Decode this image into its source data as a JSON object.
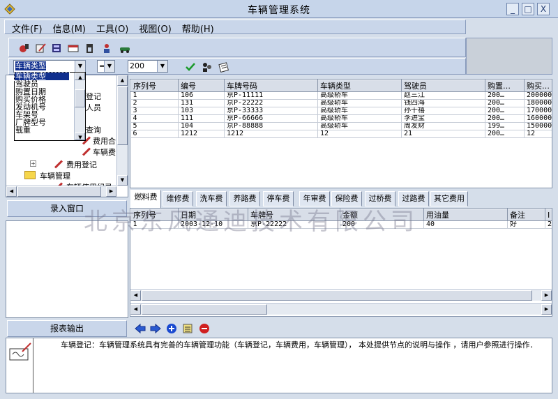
{
  "window": {
    "title": "车辆管理系统",
    "min": "_",
    "max": "□",
    "close": "X"
  },
  "menu": [
    {
      "label": "文件(F)"
    },
    {
      "label": "信息(M)"
    },
    {
      "label": "工具(O)"
    },
    {
      "label": "视图(O)"
    },
    {
      "label": "帮助(H)"
    }
  ],
  "filter": {
    "field": "车辆类型",
    "operator": "=",
    "value": "200"
  },
  "dropdown_options": [
    "车辆类型",
    "驾驶员",
    "购置日期",
    "购买价格",
    "发动机号",
    "车架号",
    "厂牌型号",
    "载重"
  ],
  "tree": {
    "nodes": [
      "登记",
      "人员",
      "查询",
      "费用合",
      "车辆费",
      "费用登记",
      "车辆管理",
      "车辆使用纪录"
    ]
  },
  "side": {
    "entry_header": "录入窗口",
    "report_header": "报表输出"
  },
  "vehicles": {
    "columns": [
      "序列号",
      "编号",
      "车牌号码",
      "车辆类型",
      "驾驶员",
      "购置…",
      "购买…"
    ],
    "rows": [
      [
        "1",
        "106",
        "京P-11111",
        "高级轿车",
        "赵三江",
        "200…",
        "200000"
      ],
      [
        "2",
        "131",
        "京P-22222",
        "高级轿车",
        "钱四海",
        "200…",
        "180000"
      ],
      [
        "3",
        "103",
        "京P-33333",
        "高级轿车",
        "孙千禧",
        "200…",
        "170000"
      ],
      [
        "4",
        "111",
        "京P-66666",
        "高级轿车",
        "李进宝",
        "200…",
        "160000"
      ],
      [
        "5",
        "104",
        "京P-88888",
        "高级轿车",
        "周发财",
        "199…",
        "150000"
      ],
      [
        "6",
        "1212",
        "1212",
        "12",
        "21",
        "200…",
        "12"
      ]
    ]
  },
  "tabs": [
    "燃料费",
    "维修费",
    "洗车费",
    "养路费",
    "停车费",
    "年审费",
    "保险费",
    "过桥费",
    "过路费",
    "其它费用"
  ],
  "fuel": {
    "columns": [
      "序列号",
      "日期",
      "车牌号",
      "金额",
      "用油量",
      "备注",
      "I"
    ],
    "rows": [
      [
        "1",
        "2003-12-10",
        "京P-22222",
        "200",
        "40",
        "好",
        "2"
      ]
    ]
  },
  "description": "车辆登记：车辆管理系统具有完善的车辆管理功能（车辆登记，车辆费用，车辆管理）， 本处提供节点的说明与操作 ，请用户参照进行操作．",
  "watermark": "北京东风通迪技术有限公司",
  "colors": {
    "accent": "#102f8e",
    "panel": "#c9d6ea",
    "background": "#d5deea"
  }
}
